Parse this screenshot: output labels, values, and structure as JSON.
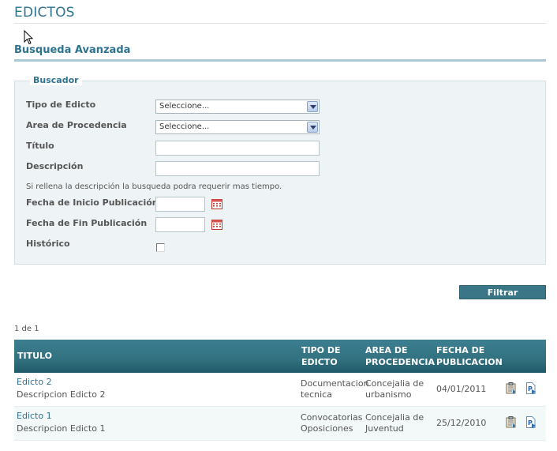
{
  "page": {
    "title": "EDICTOS"
  },
  "section": {
    "title": "Busqueda Avanzada"
  },
  "search_form": {
    "legend": "Buscador",
    "tipo_label": "Tipo de Edicto",
    "tipo_value": "Seleccione...",
    "area_label": "Area de Procedencia",
    "area_value": "Seleccione...",
    "titulo_label": "Título",
    "titulo_value": "",
    "descripcion_label": "Descripción",
    "descripcion_value": "",
    "hint": "Si rellena la descripción la busqueda podra requerir mas tiempo.",
    "fecha_inicio_label": "Fecha de Inicio Publicación",
    "fecha_inicio_value": "",
    "fecha_fin_label": "Fecha de Fin Publicación",
    "fecha_fin_value": "",
    "historico_label": "Histórico",
    "historico_checked": false,
    "filter_button": "Filtrar"
  },
  "results": {
    "pager": "1 de 1",
    "headers": {
      "titulo": "TITULO",
      "tipo_1": "TIPO DE",
      "tipo_2": "EDICTO",
      "area_1": "AREA DE",
      "area_2": "PROCEDENCIA",
      "fecha_1": "FECHA DE",
      "fecha_2": "PUBLICACION"
    },
    "rows": [
      {
        "title": "Edicto 2",
        "description": "Descripcion Edicto 2",
        "tipo_1": "Documentacion",
        "tipo_2": "tecnica",
        "area_1": "Concejalia de",
        "area_2": "urbanismo",
        "fecha": "04/01/2011"
      },
      {
        "title": "Edicto 1",
        "description": "Descripcion Edicto 1",
        "tipo_1": "Convocatorias",
        "tipo_2": "Oposiciones",
        "area_1": "Concejalia de",
        "area_2": "Juventud",
        "fecha": "25/12/2010"
      }
    ]
  },
  "icons": {
    "calendar": "calendar-icon",
    "details": "clipboard-icon",
    "pdf": "pdf-document-icon",
    "cursor": "mouse-pointer-icon"
  },
  "colors": {
    "brand": "#2e7390",
    "header_bg": "#32717f",
    "panel_bg": "#eef4f5",
    "button_bg": "#3b7687"
  }
}
